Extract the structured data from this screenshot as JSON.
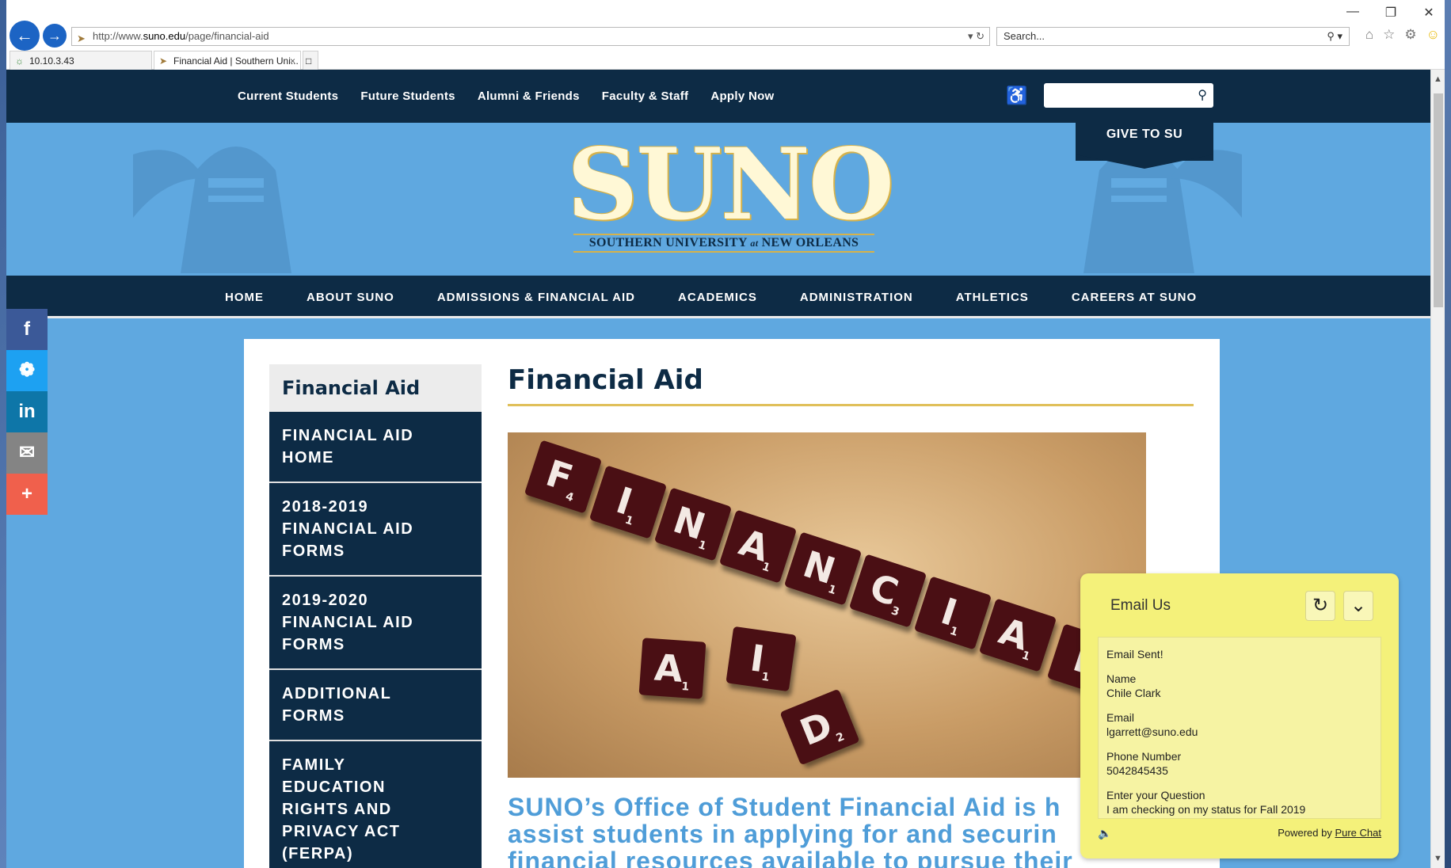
{
  "browser": {
    "url_prefix": "http://www.",
    "url_host": "suno.edu",
    "url_path": "/page/financial-aid",
    "search_placeholder": "Search...",
    "tabs": [
      {
        "label": "10.10.3.43"
      },
      {
        "label": "Financial Aid | Southern Uni..."
      }
    ]
  },
  "utility_nav": [
    "Current Students",
    "Future Students",
    "Alumni & Friends",
    "Faculty & Staff",
    "Apply Now"
  ],
  "give_label": "GIVE TO SU",
  "logo": {
    "main": "SUNO",
    "sub_left": "SOUTHERN UNIVERSITY ",
    "sub_at": "at",
    "sub_right": " NEW ORLEANS"
  },
  "main_nav": [
    "HOME",
    "ABOUT SUNO",
    "ADMISSIONS & FINANCIAL AID",
    "ACADEMICS",
    "ADMINISTRATION",
    "ATHLETICS",
    "CAREERS AT SUNO"
  ],
  "sidebar": {
    "title": "Financial Aid",
    "items": [
      [
        "FINANCIAL AID",
        "HOME"
      ],
      [
        "2018-2019",
        "FINANCIAL AID",
        "FORMS"
      ],
      [
        "2019-2020",
        "FINANCIAL AID",
        "FORMS"
      ],
      [
        "ADDITIONAL",
        "FORMS"
      ],
      [
        "FAMILY",
        "EDUCATION",
        "RIGHTS AND",
        "PRIVACY ACT",
        "(FERPA)"
      ]
    ]
  },
  "page_title": "Financial Aid",
  "hero_tiles": [
    {
      "letter": "F",
      "score": "4"
    },
    {
      "letter": "I",
      "score": "1"
    },
    {
      "letter": "N",
      "score": "1"
    },
    {
      "letter": "A",
      "score": "1"
    },
    {
      "letter": "N",
      "score": "1"
    },
    {
      "letter": "C",
      "score": "3"
    },
    {
      "letter": "I",
      "score": "1"
    },
    {
      "letter": "A",
      "score": "1"
    },
    {
      "letter": "L",
      "score": ""
    },
    {
      "letter": "A",
      "score": "1"
    },
    {
      "letter": "I",
      "score": "1"
    },
    {
      "letter": "D",
      "score": "2"
    }
  ],
  "intro_lines": [
    "SUNO’s Office of Student Financial Aid is h",
    "assist students in applying for and securin",
    "financial resources available to pursue their"
  ],
  "chat": {
    "title": "Email Us",
    "status": "Email Sent!",
    "fields": [
      {
        "label": "Name",
        "value": "Chile Clark"
      },
      {
        "label": "Email",
        "value": "lgarrett@suno.edu"
      },
      {
        "label": "Phone Number",
        "value": "5042845435"
      },
      {
        "label": "Enter your Question",
        "value": "I am checking on my status for Fall 2019"
      }
    ],
    "powered_by": "Powered by ",
    "powered_link": "Pure Chat"
  },
  "social_icons": [
    "facebook-icon",
    "twitter-icon",
    "linkedin-icon",
    "email-icon",
    "share-plus-icon"
  ],
  "colors": {
    "navy": "#0d2b45",
    "sky": "#5fa8e0",
    "gold": "#e0c05a",
    "chat_yellow": "#f4f17a"
  }
}
